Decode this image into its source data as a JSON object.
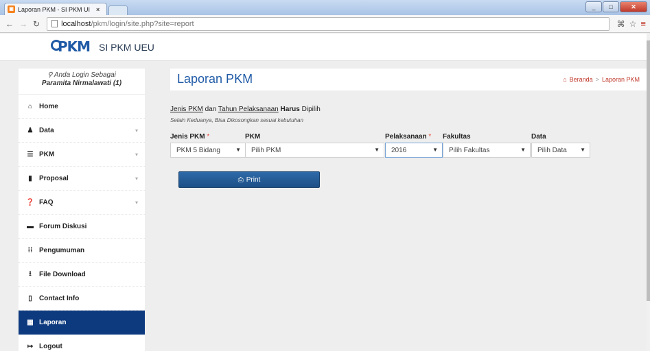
{
  "browser": {
    "tab_title": "Laporan PKM - SI PKM UI",
    "tab_close": "×",
    "url_host": "localhost",
    "url_path": "/pkm/login/site.php?site=report"
  },
  "header": {
    "logo_text": "PKM",
    "site_title": "SI PKM UEU"
  },
  "sidebar": {
    "login_label": "Anda Login Sebagai",
    "login_user": "Paramita Nirmalawati (1)",
    "items": [
      {
        "label": "Home",
        "icon": "home-icon",
        "glyph": "🏠"
      },
      {
        "label": "Data",
        "icon": "user-icon",
        "glyph": "👤"
      },
      {
        "label": "PKM",
        "icon": "list-icon",
        "glyph": "☰"
      },
      {
        "label": "Proposal",
        "icon": "book-icon",
        "glyph": "▮"
      },
      {
        "label": "FAQ",
        "icon": "question-icon",
        "glyph": "❓"
      },
      {
        "label": "Forum Diskusi",
        "icon": "comment-icon",
        "glyph": "▬"
      },
      {
        "label": "Pengumuman",
        "icon": "grid-icon",
        "glyph": "⁞⁞"
      },
      {
        "label": "File Download",
        "icon": "download-icon",
        "glyph": "⭳"
      },
      {
        "label": "Contact Info",
        "icon": "phone-icon",
        "glyph": "▯"
      },
      {
        "label": "Laporan",
        "icon": "report-icon",
        "glyph": "▦"
      },
      {
        "label": "Logout",
        "icon": "logout-icon",
        "glyph": "↦"
      }
    ]
  },
  "main": {
    "title": "Laporan PKM",
    "breadcrumb_home": "Beranda",
    "breadcrumb_sep": ">",
    "breadcrumb_current": "Laporan PKM",
    "notice_part1": "Jenis PKM",
    "notice_part2": " dan ",
    "notice_part3": "Tahun Pelaksanaan",
    "notice_part4": " Harus",
    "notice_part5": " Dipilih",
    "subnote": "Selain Keduanya, Bisa Dikosongkan sesuai kebutuhan",
    "required_mark": "*",
    "filters": {
      "jenis_label": "Jenis PKM",
      "jenis_value": "PKM 5 Bidang",
      "pkm_label": "PKM",
      "pkm_value": "Pilih PKM",
      "pelaksanaan_label": "Pelaksanaan",
      "pelaksanaan_value": "2016",
      "fakultas_label": "Fakultas",
      "fakultas_value": "Pilih Fakultas",
      "data_label": "Data",
      "data_value": "Pilih Data"
    },
    "print_label": "Print"
  },
  "colors": {
    "primary": "#1f5aa6",
    "sidebar_active": "#0d3a7f",
    "breadcrumb": "#c0392b",
    "required": "#e74c3c"
  }
}
